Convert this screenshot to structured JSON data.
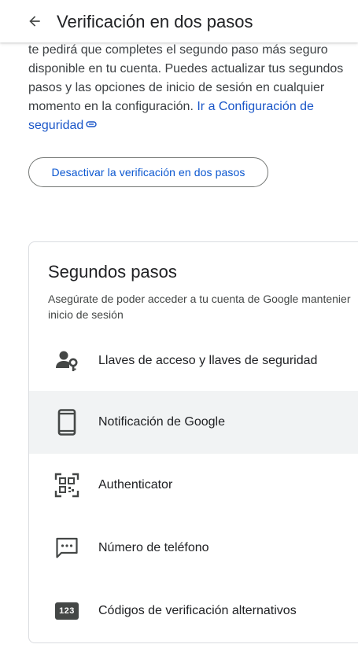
{
  "header": {
    "title": "Verificación en dos pasos",
    "back_icon": "arrow-back-icon"
  },
  "intro": {
    "text": "te pedirá que completes el segundo paso más seguro disponible en tu cuenta. Puedes actualizar tus segundos pasos y las opciones de inicio de sesión en cualquier momento en la configuración. ",
    "link_text": "Ir a Configuración de seguridad",
    "link_icon": "external-link-icon"
  },
  "disable_button": {
    "label": "Desactivar la verificación en dos pasos"
  },
  "second_steps": {
    "title": "Segundos pasos",
    "description": "Asegúrate de poder acceder a tu cuenta de Google manteniendo esta información actualizada y agregando más opciones de inicio de sesión",
    "description_visible": "Asegúrate de poder acceder a tu cuenta de Google mantenier\ninicio de sesión",
    "options": [
      {
        "label": "Llaves de acceso y llaves de seguridad",
        "icon": "passkey-icon"
      },
      {
        "label": "Notificación de Google",
        "icon": "phone-icon"
      },
      {
        "label": "Authenticator",
        "icon": "qr-code-icon"
      },
      {
        "label": "Número de teléfono",
        "icon": "sms-icon"
      },
      {
        "label": "Códigos de verificación alternativos",
        "icon": "backup-codes-icon",
        "badge": "123"
      }
    ]
  },
  "colors": {
    "link": "#1a56c8",
    "button_text": "#0b57d0",
    "highlight_row": "#f1f3f4",
    "icon": "#444746"
  }
}
